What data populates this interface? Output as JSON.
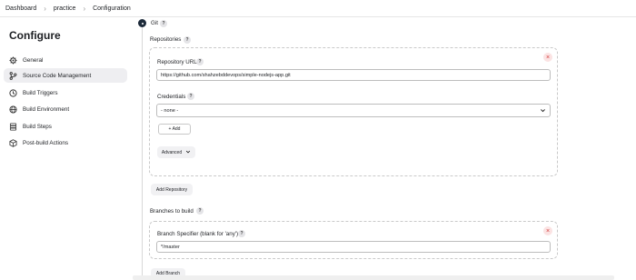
{
  "breadcrumb": {
    "items": [
      "Dashboard",
      "practice",
      "Configuration"
    ]
  },
  "sidebar": {
    "title": "Configure",
    "items": [
      {
        "label": "General",
        "icon": "gear-icon"
      },
      {
        "label": "Source Code Management",
        "icon": "branch-icon",
        "active": true
      },
      {
        "label": "Build Triggers",
        "icon": "clock-icon"
      },
      {
        "label": "Build Environment",
        "icon": "globe-icon"
      },
      {
        "label": "Build Steps",
        "icon": "steps-icon"
      },
      {
        "label": "Post-build Actions",
        "icon": "package-icon"
      }
    ]
  },
  "scm": {
    "git_label": "Git",
    "repositories_label": "Repositories",
    "repo_url_label": "Repository URL",
    "repo_url_value": "https://github.com/shahzebddevops/simple-nodejs-app.git",
    "credentials_label": "Credentials",
    "credentials_value": "- none -",
    "add_button": "+ Add",
    "advanced_button": "Advanced",
    "add_repository_button": "Add Repository",
    "branches_label": "Branches to build",
    "branch_specifier_label": "Branch Specifier (blank for 'any')",
    "branch_specifier_value": "*/master",
    "add_branch_button": "Add Branch",
    "help_glyph": "?",
    "close_glyph": "×"
  }
}
